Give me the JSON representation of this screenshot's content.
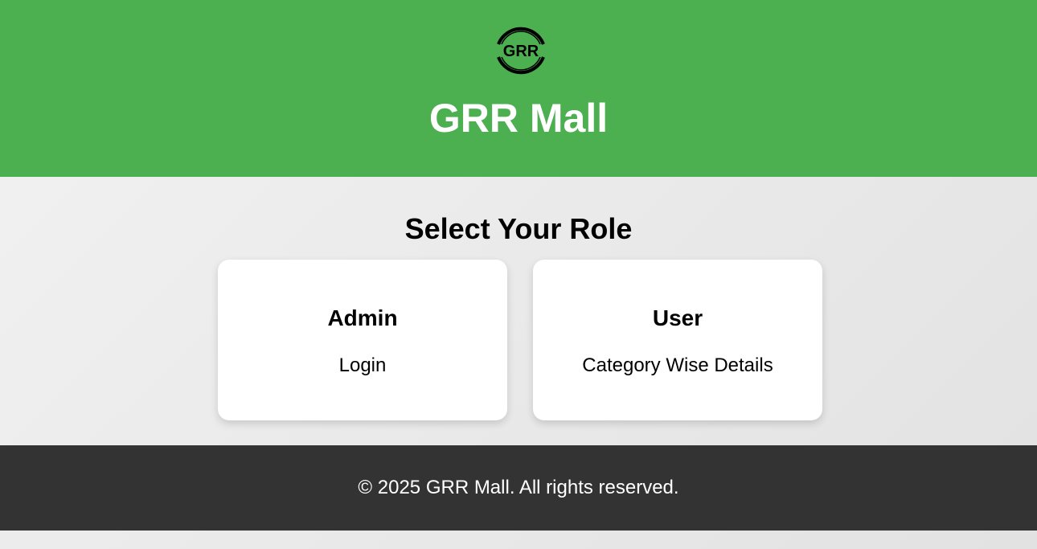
{
  "header": {
    "logo_text": "GRR",
    "site_title": "GRR Mall",
    "background_color": "#4caf50"
  },
  "main": {
    "section_title": "Select Your Role",
    "cards": [
      {
        "title": "Admin",
        "description": "Login"
      },
      {
        "title": "User",
        "description": "Category Wise Details"
      }
    ]
  },
  "footer": {
    "text": "© 2025 GRR Mall. All rights reserved.",
    "background_color": "#333333"
  }
}
